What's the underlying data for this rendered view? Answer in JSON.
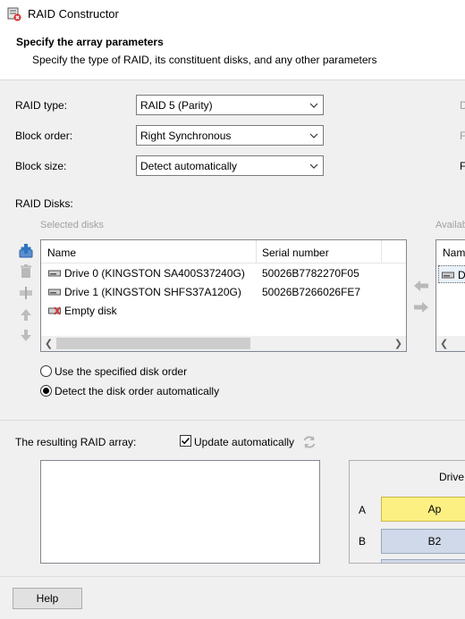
{
  "window": {
    "title": "RAID Constructor"
  },
  "header": {
    "title": "Specify the array parameters",
    "subtitle": "Specify the type of RAID, its constituent disks, and any other parameters"
  },
  "params": {
    "raid_type_label": "RAID type:",
    "raid_type_value": "RAID 5 (Parity)",
    "block_order_label": "Block order:",
    "block_order_value": "Right Synchronous",
    "block_size_label": "Block size:",
    "block_size_value": "Detect automatically",
    "edge_letters": [
      "D",
      "F",
      "F"
    ]
  },
  "disks": {
    "section_label": "RAID Disks:",
    "selected_caption": "Selected disks",
    "available_caption": "Availab",
    "columns": {
      "name": "Name",
      "serial": "Serial number"
    },
    "rows": [
      {
        "name": "Drive 0 (KINGSTON SA400S37240G)",
        "serial": "50026B7782270F05",
        "icon": "hard-drive-icon"
      },
      {
        "name": "Drive 1 (KINGSTON SHFS37A120G)",
        "serial": "50026B7266026FE7",
        "icon": "hard-drive-icon"
      },
      {
        "name": "Empty disk",
        "serial": "",
        "icon": "empty-disk-icon"
      }
    ],
    "available_header": "Name",
    "available_row": "D"
  },
  "order": {
    "option_specified": "Use the specified disk order",
    "option_auto": "Detect the disk order automatically",
    "selected": "auto"
  },
  "result": {
    "label": "The resulting RAID array:",
    "update_auto_label": "Update automatically",
    "update_auto_checked": true,
    "grid_header": "Drive",
    "grid_rows": [
      {
        "letter": "A",
        "cell": "Ap",
        "color": "#fdf083"
      },
      {
        "letter": "B",
        "cell": "B2",
        "color": "#cfd9e9"
      }
    ]
  },
  "footer": {
    "help_label": "Help"
  },
  "colors": {
    "accent_blue": "#2f74c0",
    "parity_yellow": "#fdf083",
    "block_blue": "#cfd9e9"
  }
}
